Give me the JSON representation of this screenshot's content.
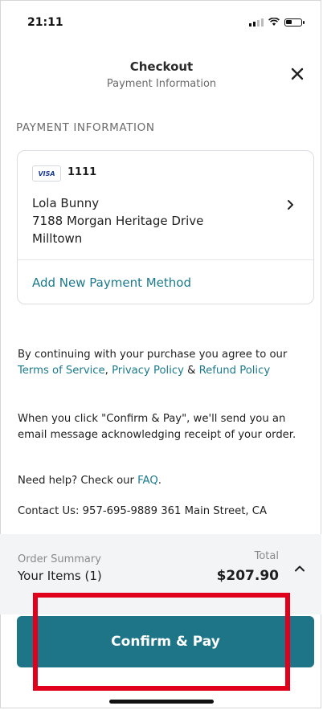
{
  "status_bar": {
    "time": "21:11"
  },
  "header": {
    "title": "Checkout",
    "subtitle": "Payment Information"
  },
  "payment": {
    "section_label": "PAYMENT INFORMATION",
    "card_brand": "VISA",
    "card_last4": "1111",
    "name": "Lola Bunny",
    "address_line1": "7188 Morgan Heritage Drive",
    "city": "Milltown",
    "add_method": "Add New Payment Method"
  },
  "legal": {
    "p1_prefix": "By continuing with your purchase you agree to our ",
    "terms": "Terms of Service",
    "sep1": ", ",
    "privacy": "Privacy Policy",
    "sep2": " & ",
    "refund": "Refund Policy",
    "p2": "When you click \"Confirm & Pay\", we'll send you an email message acknowledging receipt of your order.",
    "p3_prefix": "Need help? Check our ",
    "faq": "FAQ",
    "p3_suffix": ".",
    "contact": "Contact Us: 957-695-9889 361 Main Street, CA"
  },
  "summary": {
    "label": "Order Summary",
    "items": "Your Items (1)",
    "total_label": "Total",
    "total": "$207.90"
  },
  "actions": {
    "confirm": "Confirm & Pay"
  },
  "colors": {
    "accent": "#1e7588",
    "link": "#1b7a8c",
    "highlight": "#e0001b"
  }
}
